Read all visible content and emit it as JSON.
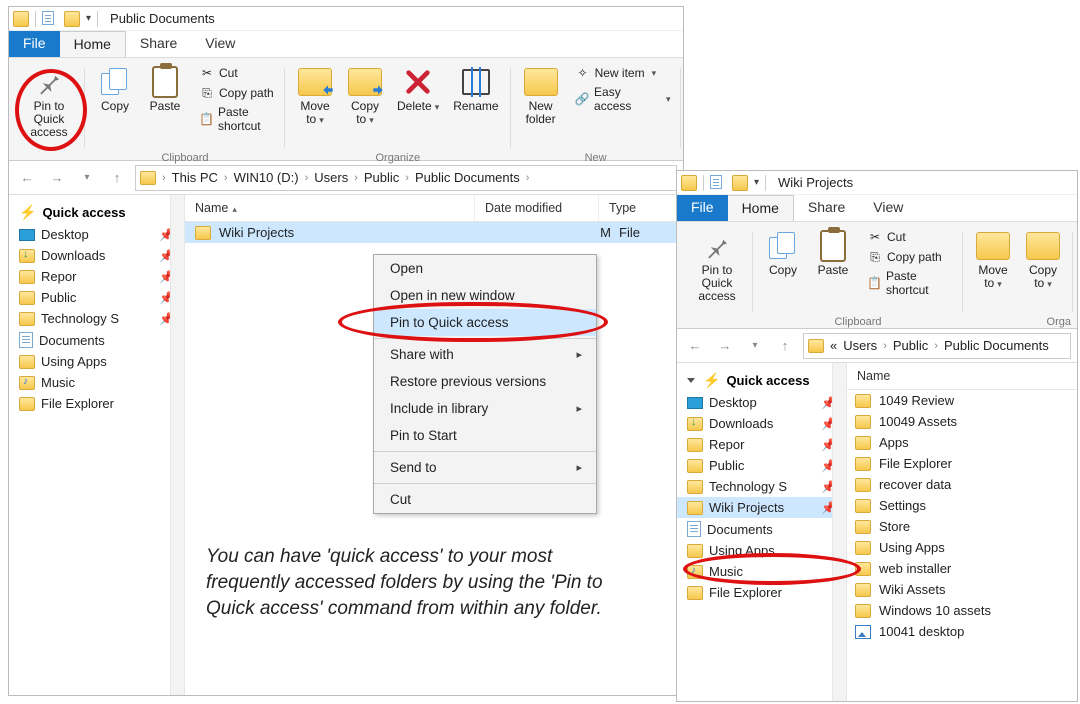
{
  "caption": "You can have 'quick access' to your most frequently accessed folders by using the 'Pin to Quick access' command from within any folder.",
  "win1": {
    "title": "Public Documents",
    "tabs": {
      "file": "File",
      "home": "Home",
      "share": "Share",
      "view": "View"
    },
    "ribbon": {
      "pin": "Pin to Quick\naccess",
      "copy": "Copy",
      "paste": "Paste",
      "cut": "Cut",
      "copypath": "Copy path",
      "pasteshort": "Paste shortcut",
      "clipboard_group": "Clipboard",
      "moveto": "Move\nto",
      "copyto": "Copy\nto",
      "delete": "Delete",
      "rename": "Rename",
      "organize_group": "Organize",
      "newfolder": "New\nfolder",
      "newitem": "New item",
      "easyaccess": "Easy access",
      "new_group": "New"
    },
    "crumbs": [
      "This PC",
      "WIN10 (D:)",
      "Users",
      "Public",
      "Public Documents"
    ],
    "columns": {
      "name": "Name",
      "date": "Date modified",
      "type": "Type"
    },
    "fileRow": {
      "name": "Wiki Projects",
      "date_frag": "M",
      "type": "File"
    },
    "sidebar": {
      "qa": "Quick access",
      "items": [
        {
          "label": "Desktop",
          "icon": "desktop",
          "pinned": true
        },
        {
          "label": "Downloads",
          "icon": "download",
          "pinned": true
        },
        {
          "label": "Repor",
          "icon": "folder",
          "pinned": true
        },
        {
          "label": "Public",
          "icon": "folder",
          "pinned": true
        },
        {
          "label": "Technology S",
          "icon": "folder",
          "pinned": true
        },
        {
          "label": "Documents",
          "icon": "doc",
          "pinned": false
        },
        {
          "label": "Using Apps",
          "icon": "folder",
          "pinned": false
        },
        {
          "label": "Music",
          "icon": "music",
          "pinned": false
        },
        {
          "label": "File Explorer",
          "icon": "folder",
          "pinned": false
        }
      ]
    },
    "ctx": [
      "Open",
      "Open in new window",
      "Pin to Quick access",
      "—",
      "Share with",
      "Restore previous versions",
      "Include in library",
      "Pin to Start",
      "—",
      "Send to",
      "—",
      "Cut"
    ]
  },
  "win2": {
    "title": "Wiki Projects",
    "tabs": {
      "file": "File",
      "home": "Home",
      "share": "Share",
      "view": "View"
    },
    "ribbon": {
      "pin": "Pin to Quick\naccess",
      "copy": "Copy",
      "paste": "Paste",
      "cut": "Cut",
      "copypath": "Copy path",
      "pasteshort": "Paste shortcut",
      "clipboard_group": "Clipboard",
      "moveto": "Move\nto",
      "copyto": "Copy\nto",
      "orga": "Orga"
    },
    "crumbs_prefix": "«",
    "crumbs": [
      "Users",
      "Public",
      "Public Documents"
    ],
    "colh": "Name",
    "sidebar": {
      "qa": "Quick access",
      "items": [
        {
          "label": "Desktop",
          "icon": "desktop",
          "pinned": true
        },
        {
          "label": "Downloads",
          "icon": "download",
          "pinned": true
        },
        {
          "label": "Repor",
          "icon": "folder",
          "pinned": true
        },
        {
          "label": "Public",
          "icon": "folder",
          "pinned": true
        },
        {
          "label": "Technology S",
          "icon": "folder",
          "pinned": true
        },
        {
          "label": "Wiki Projects",
          "icon": "folder",
          "pinned": true,
          "sel": true
        },
        {
          "label": "Documents",
          "icon": "doc",
          "pinned": false
        },
        {
          "label": "Using Apps",
          "icon": "folder",
          "pinned": false
        },
        {
          "label": "Music",
          "icon": "music",
          "pinned": false
        },
        {
          "label": "File Explorer",
          "icon": "folder",
          "pinned": false
        }
      ]
    },
    "files": [
      {
        "label": "1049 Review",
        "icon": "folder"
      },
      {
        "label": "10049 Assets",
        "icon": "folder"
      },
      {
        "label": "Apps",
        "icon": "folder"
      },
      {
        "label": "File Explorer",
        "icon": "folder"
      },
      {
        "label": "recover data",
        "icon": "folder"
      },
      {
        "label": "Settings",
        "icon": "folder"
      },
      {
        "label": "Store",
        "icon": "folder"
      },
      {
        "label": "Using Apps",
        "icon": "folder"
      },
      {
        "label": "web installer",
        "icon": "folder"
      },
      {
        "label": "Wiki Assets",
        "icon": "folder"
      },
      {
        "label": "Windows 10 assets",
        "icon": "folder"
      },
      {
        "label": "10041 desktop",
        "icon": "image"
      }
    ]
  }
}
